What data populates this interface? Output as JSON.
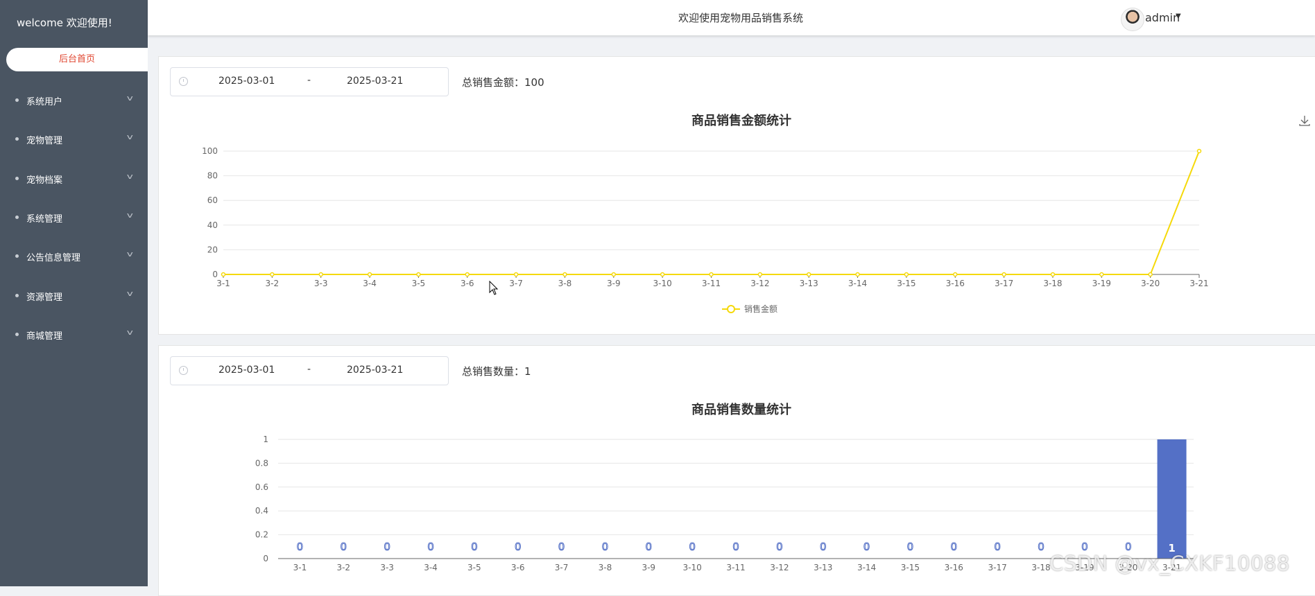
{
  "sidebar": {
    "welcome": "welcome 欢迎使用!",
    "home": "后台首页",
    "items": [
      {
        "label": "系统用户"
      },
      {
        "label": "宠物管理"
      },
      {
        "label": "宠物档案"
      },
      {
        "label": "系统管理"
      },
      {
        "label": "公告信息管理"
      },
      {
        "label": "资源管理"
      },
      {
        "label": "商城管理"
      }
    ]
  },
  "header": {
    "title": "欢迎使用宠物用品销售系统",
    "user": "admin"
  },
  "amount_panel": {
    "start_date": "2025-03-01",
    "separator": "-",
    "end_date": "2025-03-21",
    "total_label": "总销售金额：100"
  },
  "quantity_panel": {
    "start_date": "2025-03-01",
    "separator": "-",
    "end_date": "2025-03-21",
    "total_label": "总销售数量：1"
  },
  "watermark": "CSDN @vx_CXKF10088",
  "chart_data": [
    {
      "type": "line",
      "title": "商品销售金额统计",
      "categories": [
        "3-1",
        "3-2",
        "3-3",
        "3-4",
        "3-5",
        "3-6",
        "3-7",
        "3-8",
        "3-9",
        "3-10",
        "3-11",
        "3-12",
        "3-13",
        "3-14",
        "3-15",
        "3-16",
        "3-17",
        "3-18",
        "3-19",
        "3-20",
        "3-21"
      ],
      "series": [
        {
          "name": "销售金额",
          "values": [
            0,
            0,
            0,
            0,
            0,
            0,
            0,
            0,
            0,
            0,
            0,
            0,
            0,
            0,
            0,
            0,
            0,
            0,
            0,
            0,
            100
          ],
          "color": "#f5d90a"
        }
      ],
      "yticks": [
        "0",
        "20",
        "40",
        "60",
        "80",
        "100"
      ],
      "ylim": [
        0,
        100
      ],
      "grid": true,
      "legend": "bottom-center"
    },
    {
      "type": "bar",
      "title": "商品销售数量统计",
      "categories": [
        "3-1",
        "3-2",
        "3-3",
        "3-4",
        "3-5",
        "3-6",
        "3-7",
        "3-8",
        "3-9",
        "3-10",
        "3-11",
        "3-12",
        "3-13",
        "3-14",
        "3-15",
        "3-16",
        "3-17",
        "3-18",
        "3-19",
        "3-20",
        "3-21"
      ],
      "series": [
        {
          "values": [
            0,
            0,
            0,
            0,
            0,
            0,
            0,
            0,
            0,
            0,
            0,
            0,
            0,
            0,
            0,
            0,
            0,
            0,
            0,
            0,
            1
          ],
          "color": "#5470c6"
        }
      ],
      "data_labels": [
        "0",
        "0",
        "0",
        "0",
        "0",
        "0",
        "0",
        "0",
        "0",
        "0",
        "0",
        "0",
        "0",
        "0",
        "0",
        "0",
        "0",
        "0",
        "0",
        "0",
        "1"
      ],
      "yticks": [
        "0",
        "0.2",
        "0.4",
        "0.6",
        "0.8",
        "1"
      ],
      "ylim": [
        0,
        1
      ],
      "grid": true
    }
  ]
}
